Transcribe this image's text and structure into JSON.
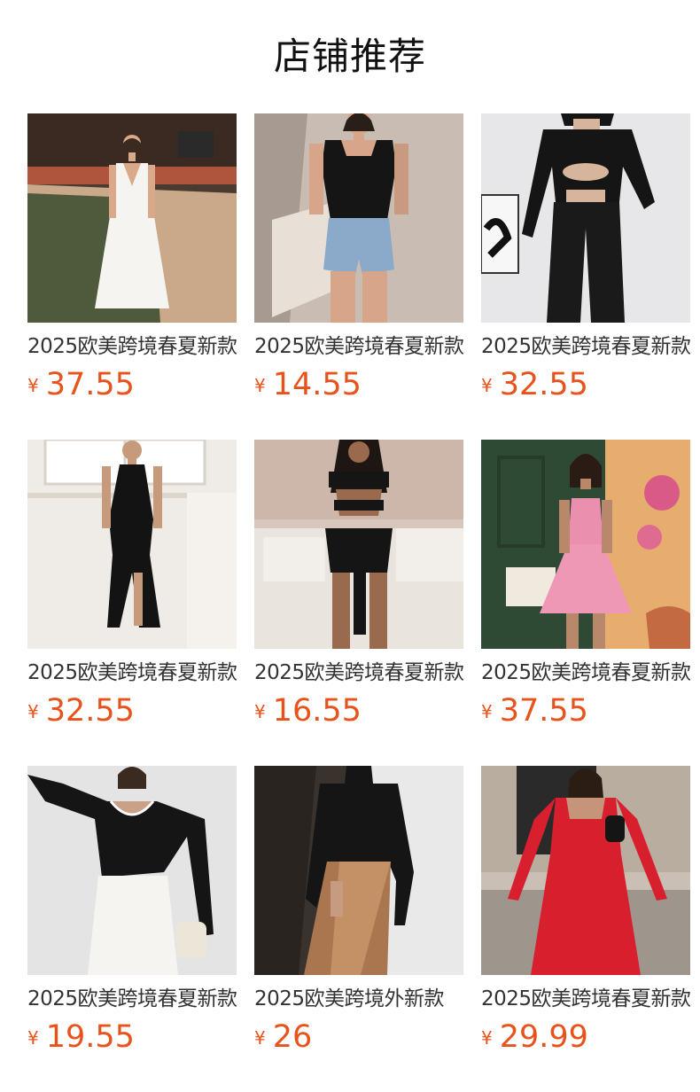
{
  "page": {
    "title": "店铺推荐"
  },
  "colors": {
    "price": "#e8531c",
    "text": "#333333"
  },
  "products": [
    {
      "name": "2025欧美跨境春夏新款",
      "currency": "¥",
      "price": "37.55",
      "image": "white-halter-maxi-dress"
    },
    {
      "name": "2025欧美跨境春夏新款",
      "currency": "¥",
      "price": "14.55",
      "image": "black-top-denim-shorts"
    },
    {
      "name": "2025欧美跨境春夏新款",
      "currency": "¥",
      "price": "32.55",
      "image": "black-cutout-top-pants"
    },
    {
      "name": "2025欧美跨境春夏新款",
      "currency": "¥",
      "price": "32.55",
      "image": "black-halter-slit-dress"
    },
    {
      "name": "2025欧美跨境春夏新款",
      "currency": "¥",
      "price": "16.55",
      "image": "black-cutout-bodysuit"
    },
    {
      "name": "2025欧美跨境春夏新款",
      "currency": "¥",
      "price": "37.55",
      "image": "pink-mini-dress"
    },
    {
      "name": "2025欧美跨境春夏新款",
      "currency": "¥",
      "price": "19.55",
      "image": "black-top-white-skirt"
    },
    {
      "name": "2025欧美跨境外新款",
      "currency": "¥",
      "price": "26",
      "image": "black-top-leather-skirt"
    },
    {
      "name": "2025欧美跨境春夏新款",
      "currency": "¥",
      "price": "29.99",
      "image": "red-square-neck-dress"
    }
  ]
}
